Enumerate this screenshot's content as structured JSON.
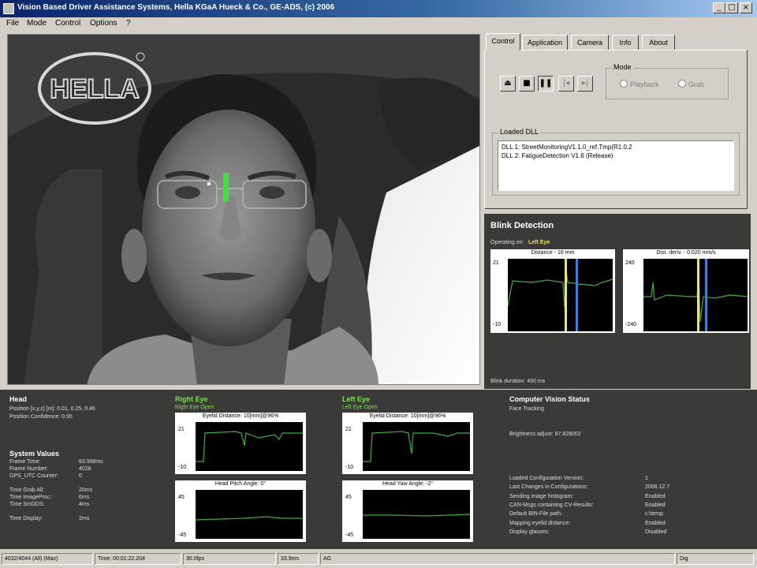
{
  "window": {
    "title": "Vision Based Driver Assistance Systems, Hella KGaA Hueck & Co., GE-ADS, (c) 2006"
  },
  "menu": [
    "File",
    "Mode",
    "Control",
    "Options",
    "?"
  ],
  "video": {
    "logo_text": "HELLA"
  },
  "tabs": [
    "Control",
    "Application",
    "Camera",
    "Info",
    "About"
  ],
  "control": {
    "mode_label": "Mode",
    "mode_options": [
      "Playback",
      "Grab"
    ],
    "loaded_dll_label": "Loaded DLL",
    "dll_items": [
      "DLL 1: StreetMonitoringV1.1.0_ref.Tmp(R1.0.2",
      "DLL 2: FatigueDetection V1.6 (Release)"
    ]
  },
  "blink": {
    "title": "Blink Detection",
    "operating_label": "Operating on:",
    "operating_value": "Left Eye",
    "plot1": {
      "title": "Distance - 16 mm",
      "ymax": "21",
      "ymin": "-10"
    },
    "plot2": {
      "title": "Dist. deriv. - 0.020 mm/s",
      "ymax": "240",
      "ymin": "-240"
    },
    "blink_duration": "Blink duration: 400 ms"
  },
  "head": {
    "title": "Head",
    "lines": [
      "Position [x,y,z] [m]: 0.01, 0.25, 0.46",
      "Position Confidence: 0.95"
    ]
  },
  "system_values": {
    "title": "System Values",
    "rows": [
      [
        "Frame Time:",
        "63.998ms"
      ],
      [
        "Frame Number:",
        "4028"
      ],
      [
        "GPS_UTC Counter:",
        "0"
      ],
      [
        "",
        ""
      ],
      [
        "Time Grab All:",
        "20ms"
      ],
      [
        "Time ImageProc.:",
        "6ms"
      ],
      [
        "Time SmDDS:",
        "4ms"
      ],
      [
        "",
        ""
      ],
      [
        "Time Display:",
        "2ms"
      ]
    ]
  },
  "right_eye": {
    "title": "Right Eye",
    "status": "Right Eye Open",
    "plot1": {
      "title": "Eyelid Distance: 10[mm]@96%",
      "ymax": "21",
      "ymin": "-10"
    },
    "plot2": {
      "title": "Head Pitch Angle: 0°",
      "ymax": "45",
      "ymin": "-45"
    }
  },
  "left_eye": {
    "title": "Left Eye",
    "status": "Left Eye Open",
    "plot1": {
      "title": "Eyelid Distance: 10[mm]@96%",
      "ymax": "21",
      "ymin": "-10"
    },
    "plot2": {
      "title": "Head Yaw Angle: -2°",
      "ymax": "45",
      "ymin": "-45"
    }
  },
  "cv_status": {
    "title": "Computer Vision Status",
    "tracking": "Face Tracking",
    "brightness": "Brightness adjust: 87.828002",
    "rows": [
      [
        "Loaded Configuration Version:",
        "1"
      ],
      [
        "Last Changes in Configurations:",
        "2006.12.7"
      ],
      [
        "Sending image histogram:",
        "Enabled"
      ],
      [
        "CAN-Msgs containing CV-Results:",
        "Enabled"
      ],
      [
        "Default BIN-File path:",
        "c:\\temp"
      ],
      [
        "Mapping eyelid distance:",
        "Enabled"
      ],
      [
        "Display glasses:",
        "Disabled"
      ]
    ]
  },
  "statusbar": [
    "4032/4044 (All) (Max)",
    "Time: 00:01:22.204",
    "30.0fps",
    "33.9ms",
    "AG",
    "Dig"
  ],
  "colors": {
    "bg": "#d4d0c8",
    "panel_dark": "#3a3a38",
    "plot_green": "#3fae3f",
    "marker_yellow": "#e8e27a",
    "marker_blue": "#3a7fd8"
  }
}
